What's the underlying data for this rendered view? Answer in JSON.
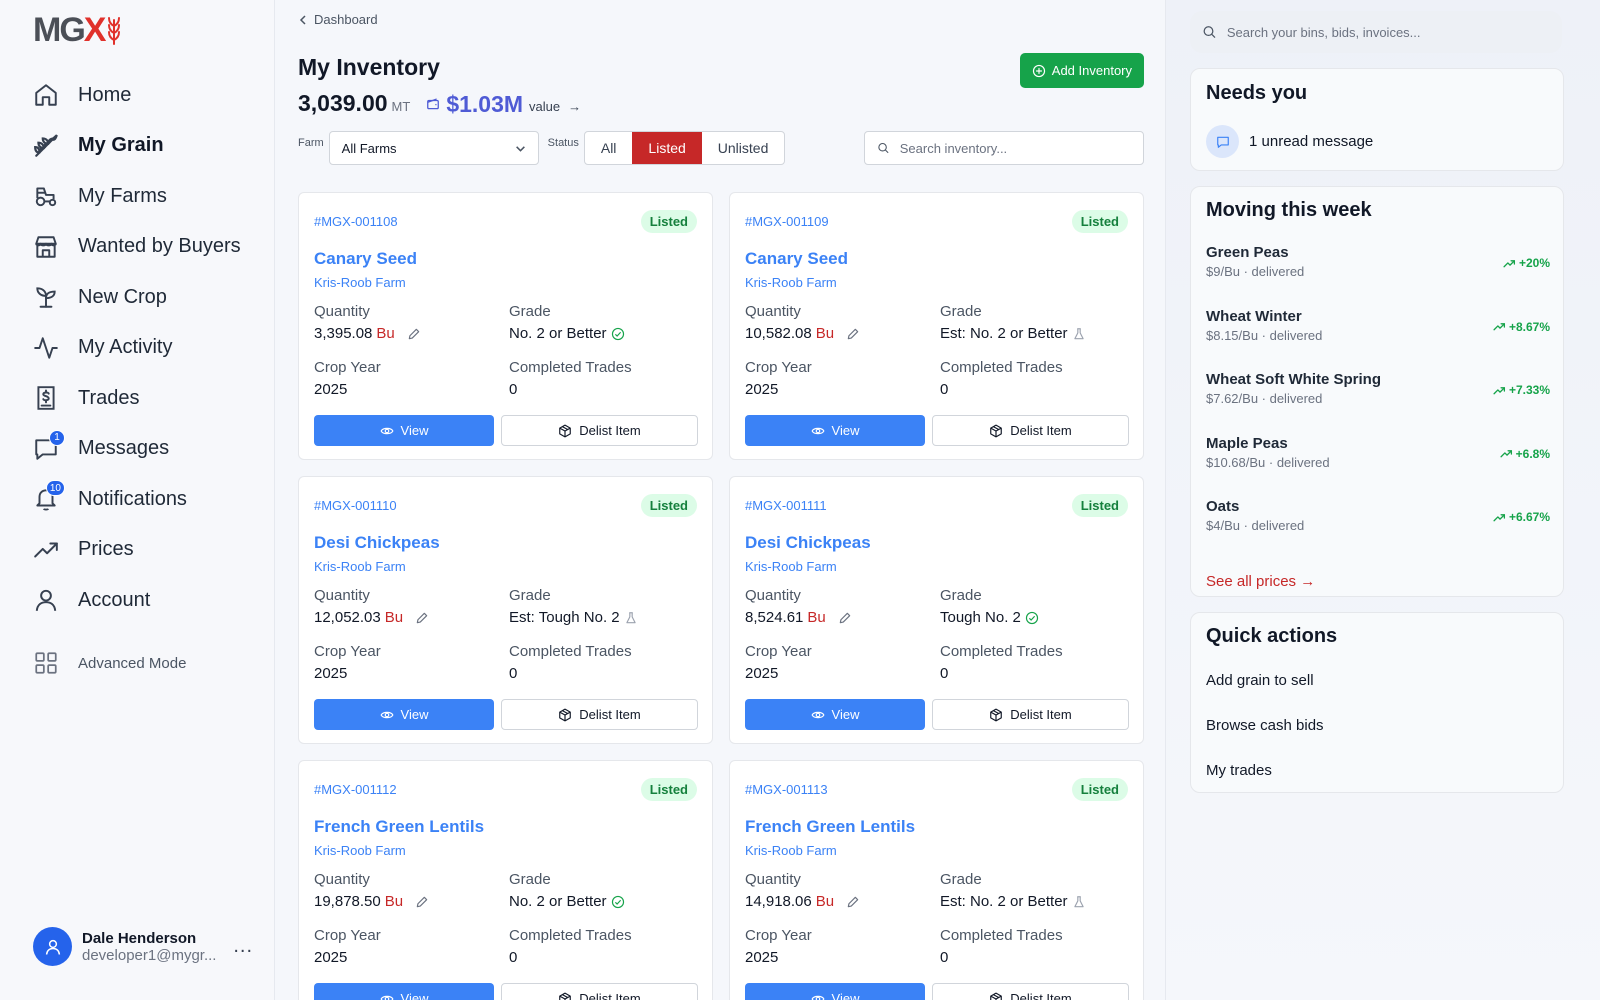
{
  "brand": {
    "logo_main": "MG",
    "logo_x": "X"
  },
  "nav": {
    "items": [
      {
        "label": "Home",
        "icon": "home-icon"
      },
      {
        "label": "My Grain",
        "icon": "grain-icon",
        "active": true
      },
      {
        "label": "My Farms",
        "icon": "tractor-icon"
      },
      {
        "label": "Wanted by Buyers",
        "icon": "store-icon"
      },
      {
        "label": "New Crop",
        "icon": "sprout-icon"
      },
      {
        "label": "My Activity",
        "icon": "activity-icon"
      },
      {
        "label": "Trades",
        "icon": "dollar-receipt-icon"
      },
      {
        "label": "Messages",
        "icon": "message-icon",
        "badge": "1"
      },
      {
        "label": "Notifications",
        "icon": "bell-icon",
        "badge": "10"
      },
      {
        "label": "Prices",
        "icon": "trending-up-icon"
      },
      {
        "label": "Account",
        "icon": "user-icon"
      }
    ],
    "advanced_label": "Advanced Mode"
  },
  "user": {
    "name": "Dale Henderson",
    "email": "developer1@mygr...",
    "more": "..."
  },
  "main": {
    "breadcrumb": "Dashboard",
    "title": "My Inventory",
    "total_mt": "3,039.00",
    "total_unit": "MT",
    "total_value": "$1.03M",
    "total_value_label": "value",
    "add_button": "Add Inventory",
    "filters": {
      "farm_label": "Farm",
      "farm_value": "All Farms",
      "status_label": "Status",
      "status_options": [
        "All",
        "Listed",
        "Unlisted"
      ],
      "status_selected": "Listed",
      "search_placeholder": "Search inventory..."
    },
    "labels": {
      "quantity": "Quantity",
      "grade": "Grade",
      "crop_year": "Crop Year",
      "completed_trades": "Completed Trades",
      "view": "View",
      "delist": "Delist Item"
    },
    "cards": [
      {
        "id": "#MGX-001108",
        "status": "Listed",
        "name": "Canary Seed",
        "farm": "Kris-Roob Farm",
        "quantity": "3,395.08",
        "unit": "Bu",
        "grade": "No. 2 or Better",
        "grade_icon": "check-circle-icon",
        "crop_year": "2025",
        "trades": "0"
      },
      {
        "id": "#MGX-001109",
        "status": "Listed",
        "name": "Canary Seed",
        "farm": "Kris-Roob Farm",
        "quantity": "10,582.08",
        "unit": "Bu",
        "grade": "Est: No. 2 or Better",
        "grade_icon": "flask-icon",
        "crop_year": "2025",
        "trades": "0"
      },
      {
        "id": "#MGX-001110",
        "status": "Listed",
        "name": "Desi Chickpeas",
        "farm": "Kris-Roob Farm",
        "quantity": "12,052.03",
        "unit": "Bu",
        "grade": "Est: Tough No. 2",
        "grade_icon": "flask-icon",
        "crop_year": "2025",
        "trades": "0"
      },
      {
        "id": "#MGX-001111",
        "status": "Listed",
        "name": "Desi Chickpeas",
        "farm": "Kris-Roob Farm",
        "quantity": "8,524.61",
        "unit": "Bu",
        "grade": "Tough No. 2",
        "grade_icon": "check-circle-icon",
        "crop_year": "2025",
        "trades": "0"
      },
      {
        "id": "#MGX-001112",
        "status": "Listed",
        "name": "French Green Lentils",
        "farm": "Kris-Roob Farm",
        "quantity": "19,878.50",
        "unit": "Bu",
        "grade": "No. 2 or Better",
        "grade_icon": "check-circle-icon",
        "crop_year": "2025",
        "trades": "0"
      },
      {
        "id": "#MGX-001113",
        "status": "Listed",
        "name": "French Green Lentils",
        "farm": "Kris-Roob Farm",
        "quantity": "14,918.06",
        "unit": "Bu",
        "grade": "Est: No. 2 or Better",
        "grade_icon": "flask-icon",
        "crop_year": "2025",
        "trades": "0"
      }
    ]
  },
  "right": {
    "search_placeholder": "Search your bins, bids, invoices...",
    "needs_you": {
      "title": "Needs you",
      "message": "1 unread message"
    },
    "moving": {
      "title": "Moving this week",
      "items": [
        {
          "name": "Green Peas",
          "sub": "$9/Bu · delivered",
          "change": "+20%"
        },
        {
          "name": "Wheat Winter",
          "sub": "$8.15/Bu · delivered",
          "change": "+8.67%"
        },
        {
          "name": "Wheat Soft White Spring",
          "sub": "$7.62/Bu · delivered",
          "change": "+7.33%"
        },
        {
          "name": "Maple Peas",
          "sub": "$10.68/Bu · delivered",
          "change": "+6.8%"
        },
        {
          "name": "Oats",
          "sub": "$4/Bu · delivered",
          "change": "+6.67%"
        }
      ],
      "see_all": "See all prices →"
    },
    "quick_actions": {
      "title": "Quick actions",
      "items": [
        "Add grain to sell",
        "Browse cash bids",
        "My trades"
      ]
    }
  },
  "colors": {
    "accent_red": "#c62828",
    "brand_blue": "#3b82f6",
    "success_green": "#16a34a",
    "value_purple": "#4f5bd5"
  }
}
